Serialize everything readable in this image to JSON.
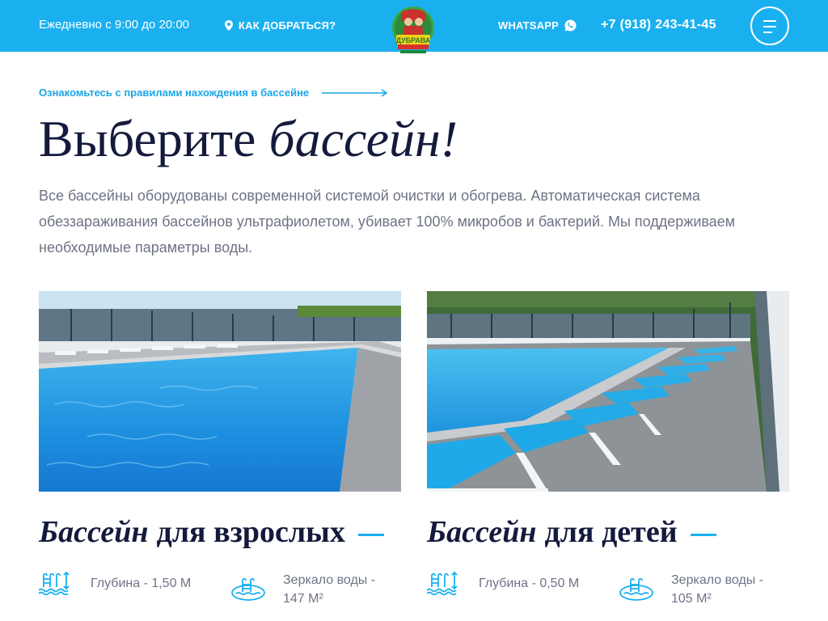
{
  "header": {
    "hours": "Ежедневно с 9:00 до 20:00",
    "directions_label": "КАК ДОБРАТЬСЯ?",
    "whatsapp_label": "WHATSAPP",
    "phone": "+7 (918) 243-41-45",
    "logo_text": "ДУБРАВА",
    "background_color": "#1ab0f0"
  },
  "main": {
    "rules_link": "Ознакомьтесь с правилами нахождения в бассейне",
    "title_plain": "Выберите ",
    "title_italic": "бассейн!",
    "intro": "Все бассейны оборудованы современной системой очистки и обогрева. Автоматическая система обеззараживания бассейнов ультрафиолетом, убивает 100% микробов и бактерий. Мы поддерживаем необходимые параметры воды."
  },
  "pools": [
    {
      "title_italic": "Бассейн",
      "title_plain": "для взрослых",
      "depth": "Глубина - 1,50 М",
      "surface_line1": "Зеркало воды -",
      "surface_line2": "147 М²"
    },
    {
      "title_italic": "Бассейн",
      "title_plain": "для детей",
      "depth": "Глубина - 0,50 М",
      "surface_line1": "Зеркало воды -",
      "surface_line2": "105 М²"
    }
  ],
  "icons": {
    "location": "map-pin-icon",
    "whatsapp": "whatsapp-icon",
    "menu": "hamburger-menu-icon",
    "arrow": "long-arrow-right-icon",
    "depth": "pool-ladder-depth-icon",
    "surface": "pool-surface-icon"
  },
  "colors": {
    "accent": "#1ab0f0",
    "title": "#141a3c",
    "body_text": "#6e7385",
    "link": "#1aa6e6"
  }
}
